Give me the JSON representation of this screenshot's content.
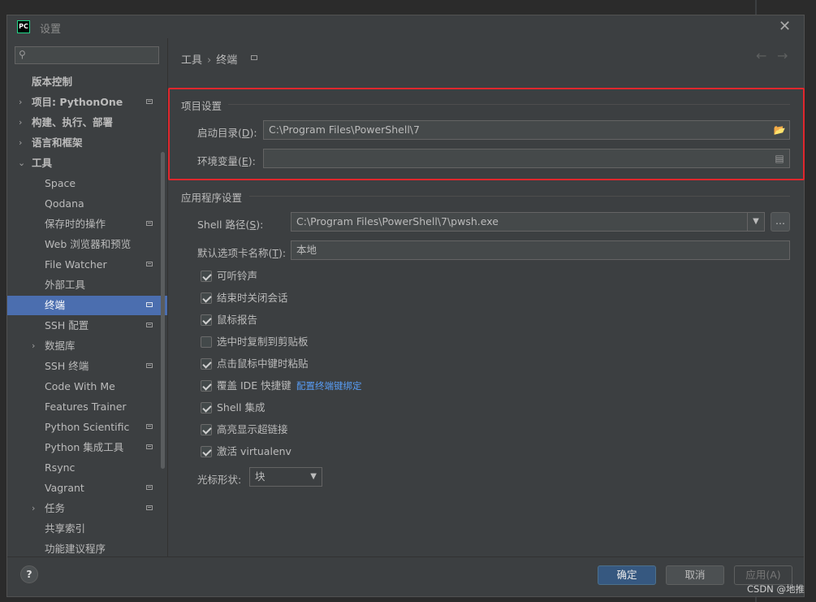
{
  "window": {
    "title": "设置",
    "app_icon_text": "PC"
  },
  "sidebar": {
    "search_placeholder": "",
    "items": [
      {
        "label": "版本控制"
      },
      {
        "label": "项目: PythonOne"
      },
      {
        "label": "构建、执行、部署"
      },
      {
        "label": "语言和框架"
      },
      {
        "label": "工具"
      },
      {
        "label": "Space"
      },
      {
        "label": "Qodana"
      },
      {
        "label": "保存时的操作"
      },
      {
        "label": "Web 浏览器和预览"
      },
      {
        "label": "File Watcher"
      },
      {
        "label": "外部工具"
      },
      {
        "label": "终端"
      },
      {
        "label": "SSH 配置"
      },
      {
        "label": "数据库"
      },
      {
        "label": "SSH 终端"
      },
      {
        "label": "Code With Me"
      },
      {
        "label": "Features Trainer"
      },
      {
        "label": "Python Scientific"
      },
      {
        "label": "Python 集成工具"
      },
      {
        "label": "Rsync"
      },
      {
        "label": "Vagrant"
      },
      {
        "label": "任务"
      },
      {
        "label": "共享索引"
      },
      {
        "label": "功能建议程序"
      }
    ]
  },
  "breadcrumb": {
    "parent": "工具",
    "separator": "›",
    "current": "终端"
  },
  "project_settings": {
    "title": "项目设置",
    "start_dir_label": "启动目录(",
    "start_dir_key": "D",
    "start_dir_label_end": "):",
    "start_dir_value": "C:\\Program Files\\PowerShell\\7",
    "env_label": "环境变量(",
    "env_key": "E",
    "env_label_end": "):",
    "env_value": ""
  },
  "app_settings": {
    "title": "应用程序设置",
    "shell_label": "Shell 路径(",
    "shell_key": "S",
    "shell_label_end": "):",
    "shell_value": "C:\\Program Files\\PowerShell\\7\\pwsh.exe",
    "shell_more": "...",
    "tab_label": "默认选项卡名称(",
    "tab_key": "T",
    "tab_label_end": "):",
    "tab_value": "本地",
    "checkboxes": [
      {
        "label": "可听铃声",
        "checked": true
      },
      {
        "label": "结束时关闭会话",
        "checked": true
      },
      {
        "label": "鼠标报告",
        "checked": true
      },
      {
        "label": "选中时复制到剪贴板",
        "checked": false
      },
      {
        "label": "点击鼠标中键时粘贴",
        "checked": true
      },
      {
        "label": "覆盖 IDE 快捷键",
        "checked": true,
        "link": "配置终端键绑定"
      },
      {
        "label": "Shell 集成",
        "checked": true
      },
      {
        "label": "高亮显示超链接",
        "checked": true
      },
      {
        "label": "激活 virtualenv",
        "checked": true
      }
    ],
    "cursor_label": "光标形状:",
    "cursor_value": "块"
  },
  "footer": {
    "help": "?",
    "ok": "确定",
    "cancel": "取消",
    "apply": "应用(A)"
  },
  "watermark": "CSDN @地推",
  "colors": {
    "highlight_box": "#e0272d",
    "selection": "#4b6eaf",
    "link": "#589df6"
  }
}
